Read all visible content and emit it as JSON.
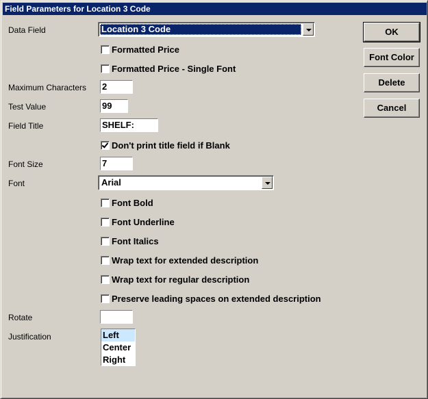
{
  "window": {
    "title": "Field Parameters for Location 3 Code"
  },
  "labels": {
    "data_field": "Data Field",
    "max_chars": "Maximum Characters",
    "test_value": "Test Value",
    "field_title": "Field Title",
    "font_size": "Font Size",
    "font": "Font",
    "rotate": "Rotate",
    "justification": "Justification"
  },
  "fields": {
    "data_field_value": "Location 3 Code",
    "max_chars": "2",
    "test_value": "99",
    "field_title": "SHELF:",
    "font_size": "7",
    "font_value": "Arial",
    "rotate": ""
  },
  "checkboxes": {
    "formatted_price": {
      "label": "Formatted Price",
      "checked": false
    },
    "formatted_price_single": {
      "label": "Formatted Price - Single Font",
      "checked": false
    },
    "dont_print_title": {
      "label": "Don't print title field if Blank",
      "checked": true
    },
    "font_bold": {
      "label": "Font Bold",
      "checked": false
    },
    "font_underline": {
      "label": "Font Underline",
      "checked": false
    },
    "font_italics": {
      "label": "Font Italics",
      "checked": false
    },
    "wrap_extended": {
      "label": "Wrap text for extended description",
      "checked": false
    },
    "wrap_regular": {
      "label": "Wrap text for regular description",
      "checked": false
    },
    "preserve_spaces": {
      "label": "Preserve leading spaces on extended description",
      "checked": false
    }
  },
  "justification_options": [
    "Left",
    "Center",
    "Right"
  ],
  "justification_selected": "Left",
  "buttons": {
    "ok": "OK",
    "font_color": "Font Color",
    "delete": "Delete",
    "cancel": "Cancel"
  },
  "colors": {
    "titlebar": "#0a246a",
    "face": "#d4d0c8",
    "list_selection": "#cce8ff"
  }
}
